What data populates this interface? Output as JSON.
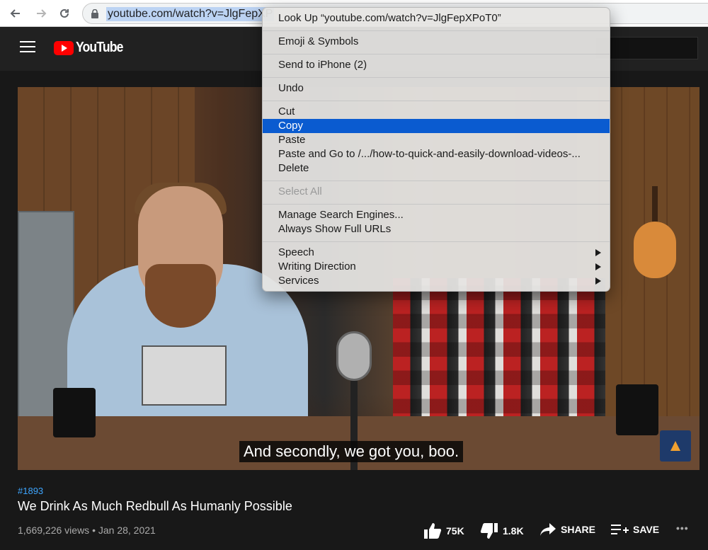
{
  "browser": {
    "url": "youtube.com/watch?v=JlgFepXP"
  },
  "youtube": {
    "logo_text": "YouTube"
  },
  "video": {
    "caption": "And secondly, we got you, boo.",
    "hashtag": "#1893",
    "title": "We Drink As Much Redbull As Humanly Possible",
    "views_date": "1,669,226 views • Jan 28, 2021",
    "likes": "75K",
    "dislikes": "1.8K",
    "share_label": "SHARE",
    "save_label": "SAVE",
    "more_label": "•••"
  },
  "context_menu": {
    "items": [
      {
        "label": "Look Up “youtube.com/watch?v=JlgFepXPoT0”"
      },
      {
        "label": "Emoji & Symbols"
      },
      {
        "label": "Send to iPhone (2)"
      },
      {
        "label": "Undo"
      },
      {
        "label": "Cut"
      },
      {
        "label": "Copy",
        "selected": true
      },
      {
        "label": "Paste"
      },
      {
        "label": "Paste and Go to /.../how-to-quick-and-easily-download-videos-..."
      },
      {
        "label": "Delete"
      },
      {
        "label": "Select All",
        "disabled": true
      },
      {
        "label": "Manage Search Engines..."
      },
      {
        "label": "Always Show Full URLs"
      },
      {
        "label": "Speech"
      },
      {
        "label": "Writing Direction"
      },
      {
        "label": "Services"
      }
    ]
  },
  "colors": {
    "menu_highlight": "#0a5bd0",
    "link_blue": "#3ea6ff",
    "youtube_red": "#ff0000"
  }
}
